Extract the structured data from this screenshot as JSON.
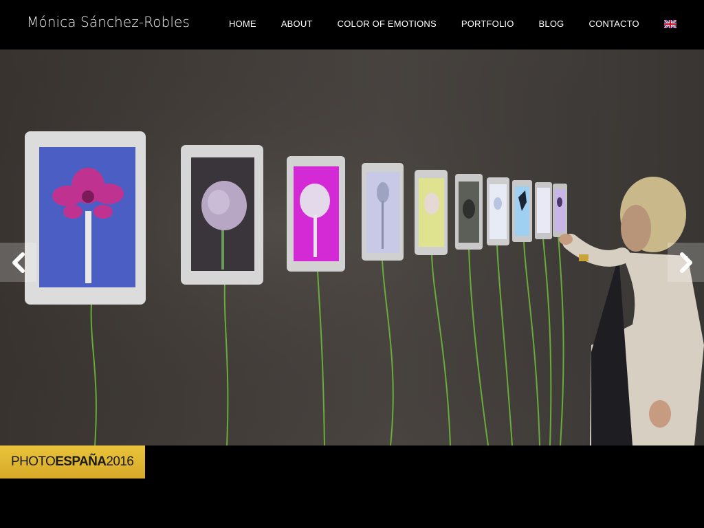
{
  "header": {
    "logo_text": "Mónica Sánchez-Robles",
    "nav": [
      {
        "label": "HOME"
      },
      {
        "label": "ABOUT"
      },
      {
        "label": "COLOR OF EMOTIONS"
      },
      {
        "label": "PORTFOLIO"
      },
      {
        "label": "BLOG"
      },
      {
        "label": "CONTACTO"
      }
    ],
    "language_flag": "uk-flag-icon"
  },
  "slider": {
    "prev_icon": "chevron-left-icon",
    "next_icon": "chevron-right-icon"
  },
  "badge": {
    "part1": "PHOTO",
    "part2": "ESPAÑA",
    "part3": "2016"
  },
  "colors": {
    "header_bg": "#000000",
    "nav_text": "#ffffff",
    "badge_gold": "#e0b832"
  }
}
